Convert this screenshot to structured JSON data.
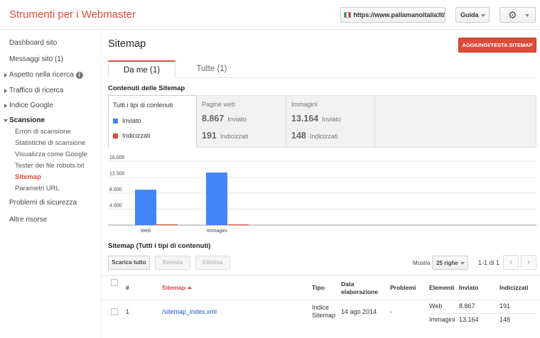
{
  "header": {
    "app_title": "Strumenti per i Webmaster",
    "site_url": "https://www.pallamanoitalia.it/",
    "help_label": "Guida",
    "settings_icon": "gear-icon"
  },
  "sidebar": {
    "dashboard": "Dashboard sito",
    "messages": "Messaggi sito (1)",
    "search_appearance": "Aspetto nella ricerca",
    "search_traffic": "Traffico di ricerca",
    "google_index": "Indice Google",
    "crawl": "Scansione",
    "crawl_items": [
      "Errori di scansione",
      "Statistiche di scansione",
      "Visualizza come Google",
      "Tester dei file robots.txt",
      "Sitemap",
      "Parametri URL"
    ],
    "security": "Problemi di sicurezza",
    "other": "Altre risorse"
  },
  "page": {
    "title": "Sitemap",
    "add_button": "AGGIUNGI/TESTA SITEMAP",
    "tabs": [
      "Da me (1)",
      "Tutte (1)"
    ],
    "content_label": "Contenuti delle Sitemap"
  },
  "summary": {
    "all_types": "Tutti i tipi di contenuti",
    "legend_submitted": "Inviato",
    "legend_indexed": "Indicizzati",
    "web": {
      "label": "Pagine web",
      "submitted": "8.867",
      "indexed": "191",
      "submitted_lbl": "Inviato",
      "indexed_lbl": "Indicizzati"
    },
    "images": {
      "label": "Immagini",
      "submitted": "13.164",
      "indexed": "148",
      "submitted_lbl": "Inviato",
      "indexed_lbl": "Indicizzati"
    }
  },
  "colors": {
    "submitted": "#4285f4",
    "indexed": "#dd4b39",
    "accent": "#dd4b39"
  },
  "chart_data": {
    "type": "bar",
    "categories": [
      "Web",
      "Immagini"
    ],
    "series": [
      {
        "name": "Inviato",
        "values": [
          8867,
          13164
        ]
      },
      {
        "name": "Indicizzati",
        "values": [
          191,
          148
        ]
      }
    ],
    "yticks": [
      "16.000",
      "12.000",
      "8.000",
      "4.000"
    ],
    "ylim": [
      0,
      16000
    ],
    "grid": true
  },
  "list": {
    "title": "Sitemap (Tutti i tipi di contenuti)",
    "download_all": "Scarica tutto",
    "resend": "Reinvia",
    "delete": "Elimina",
    "show": "Mostra",
    "rows": "25 righe",
    "pager": "1-1 di 1",
    "headers": {
      "num": "#",
      "sitemap": "Sitemap",
      "type": "Tipo",
      "date_1": "Data",
      "date_2": "elaborazione",
      "problems": "Problemi",
      "items": "Elementi",
      "submitted": "Inviato",
      "indexed": "Indicizzati"
    },
    "row": {
      "num": "1",
      "sitemap": "/sitemap_index.xml",
      "type_1": "Indice",
      "type_2": "Sitemap",
      "date": "14 ago 2014",
      "problems": "-",
      "web_label": "Web",
      "web_submitted": "8.867",
      "web_indexed": "191",
      "img_label": "Immagini",
      "img_submitted": "13.164",
      "img_indexed": "148"
    }
  }
}
